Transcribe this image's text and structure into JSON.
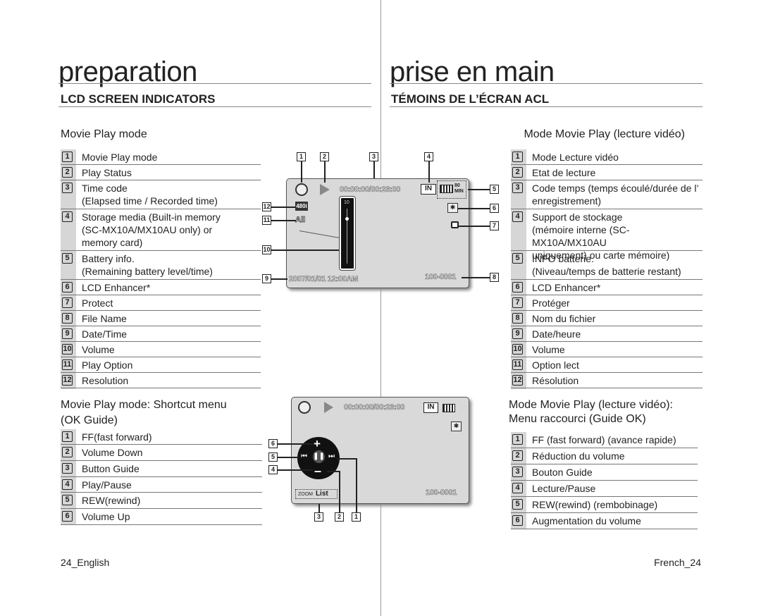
{
  "left": {
    "title": "preparation",
    "section": "LCD SCREEN INDICATORS",
    "subtitle": "Movie Play mode",
    "items": [
      {
        "num": "1",
        "text": "Movie Play mode"
      },
      {
        "num": "2",
        "text": "Play Status"
      },
      {
        "num": "3",
        "text": "Time code",
        "text2": "(Elapsed time / Recorded time)"
      },
      {
        "num": "4",
        "text": "Storage media (Built-in memory",
        "text2": "(SC-MX10A/MX10AU only) or",
        "text3": "memory card)"
      },
      {
        "num": "5",
        "text": "Battery info.",
        "text2": "(Remaining battery level/time)"
      },
      {
        "num": "6",
        "text": "LCD Enhancer*"
      },
      {
        "num": "7",
        "text": "Protect"
      },
      {
        "num": "8",
        "text": "File Name"
      },
      {
        "num": "9",
        "text": "Date/Time"
      },
      {
        "num": "10",
        "text": "Volume"
      },
      {
        "num": "11",
        "text": "Play Option"
      },
      {
        "num": "12",
        "text": "Resolution"
      }
    ],
    "subtitle2": "Movie Play mode: Shortcut menu",
    "subtitle2b": "(OK Guide)",
    "items2": [
      {
        "num": "1",
        "text": "FF(fast forward)"
      },
      {
        "num": "2",
        "text": "Volume Down"
      },
      {
        "num": "3",
        "text": "Button Guide"
      },
      {
        "num": "4",
        "text": "Play/Pause"
      },
      {
        "num": "5",
        "text": "REW(rewind)"
      },
      {
        "num": "6",
        "text": "Volume Up"
      }
    ],
    "footer": "24_English"
  },
  "right": {
    "title": "prise en main",
    "section": "TÉMOINS DE L’ÉCRAN ACL",
    "subtitle": "Mode Movie Play (lecture vidéo)",
    "items": [
      {
        "num": "1",
        "text": "Mode Lecture vidéo"
      },
      {
        "num": "2",
        "text": "Etat de lecture"
      },
      {
        "num": "3",
        "text": "Code temps (temps écoulé/durée de l’",
        "text2": "enregistrement)"
      },
      {
        "num": "4",
        "text": "Support de stockage",
        "text2": "(mémoire interne (SC-MX10A/MX10AU",
        "text3": "uniquement) ou carte mémoire)"
      },
      {
        "num": "5",
        "text": "INFO batterie.",
        "text2": "(Niveau/temps de batterie restant)"
      },
      {
        "num": "6",
        "text": "LCD Enhancer*"
      },
      {
        "num": "7",
        "text": "Protéger"
      },
      {
        "num": "8",
        "text": "Nom du fichier"
      },
      {
        "num": "9",
        "text": "Date/heure"
      },
      {
        "num": "10",
        "text": "Volume"
      },
      {
        "num": "11",
        "text": "Option lect"
      },
      {
        "num": "12",
        "text": "Résolution"
      }
    ],
    "subtitle2": "Mode Movie Play (lecture vidéo):",
    "subtitle2b": "Menu raccourci (Guide OK)",
    "items2": [
      {
        "num": "1",
        "text": "FF (fast forward) (avance rapide)"
      },
      {
        "num": "2",
        "text": "Réduction du volume"
      },
      {
        "num": "3",
        "text": "Bouton Guide"
      },
      {
        "num": "4",
        "text": "Lecture/Pause"
      },
      {
        "num": "5",
        "text": "REW(rewind) (rembobinage)"
      },
      {
        "num": "6",
        "text": "Augmentation du volume"
      }
    ],
    "footer": "French_24"
  },
  "lcd1": {
    "timecode": "00:00:00/00:23:00",
    "storage": "IN",
    "battery_time": "80 MIN",
    "resolution": "480i",
    "play_option": "All",
    "volume_max": "10",
    "datetime": "2007/01/01  12:00AM",
    "filename": "100-0001",
    "callouts": [
      "1",
      "2",
      "3",
      "4",
      "5",
      "6",
      "7",
      "8",
      "9",
      "10",
      "11",
      "12"
    ]
  },
  "lcd2": {
    "timecode": "00:00:00/00:23:00",
    "storage": "IN",
    "zoom": "ZOOM",
    "list": "List",
    "filename": "100-0001",
    "callouts": [
      "1",
      "2",
      "3",
      "4",
      "5",
      "6"
    ]
  }
}
